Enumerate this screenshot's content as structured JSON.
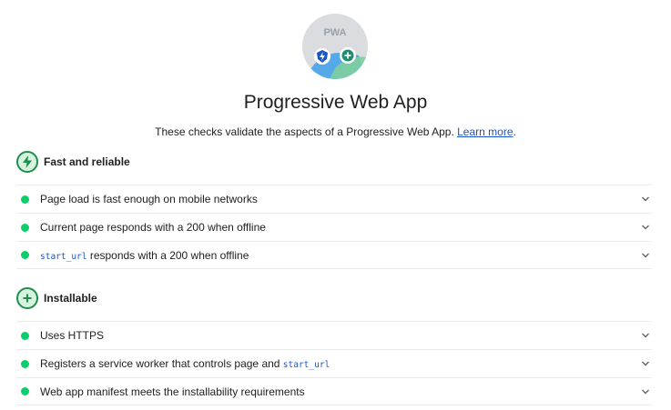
{
  "header": {
    "gauge_label": "PWA",
    "title": "Progressive Web App",
    "description": "These checks validate the aspects of a Progressive Web App.",
    "learn_more": "Learn more",
    "period": "."
  },
  "groups": [
    {
      "title": "Fast and reliable",
      "audits": [
        {
          "text": "Page load is fast enough on mobile networks"
        },
        {
          "text": "Current page responds with a 200 when offline"
        },
        {
          "code": "start_url",
          "text": " responds with a 200 when offline"
        }
      ]
    },
    {
      "title": "Installable",
      "audits": [
        {
          "text": "Uses HTTPS"
        },
        {
          "text": "Registers a service worker that controls page and ",
          "code": "start_url"
        },
        {
          "text": "Web app manifest meets the installability requirements"
        }
      ]
    }
  ],
  "colors": {
    "pass": "#0cce6b",
    "link": "#1a56c8",
    "group_icon_border": "#1e8f4a"
  },
  "icons": {
    "gauge": "pwa-gauge-icon",
    "fast_reliable": "lightning-icon",
    "installable": "plus-icon",
    "expand": "chevron-down-icon"
  }
}
